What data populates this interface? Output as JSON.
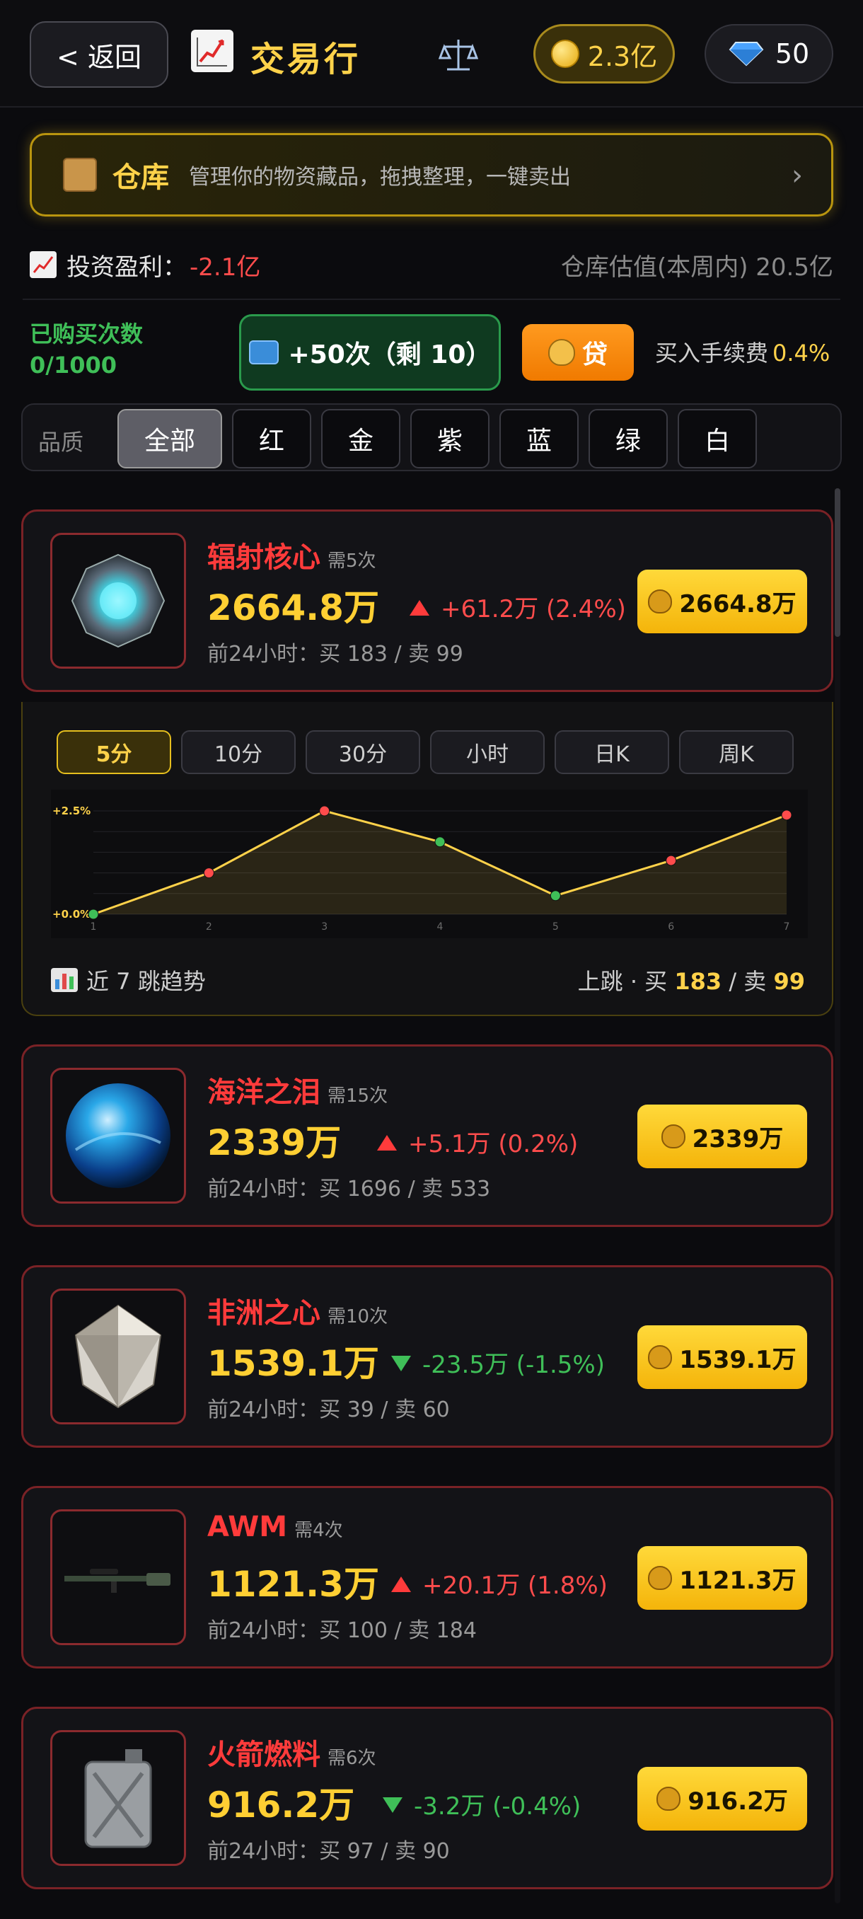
{
  "header": {
    "back_label": "< 返回",
    "title": "交易行",
    "gold_balance": "2.3亿",
    "gem_balance": "50"
  },
  "banner": {
    "title": "仓库",
    "desc": "管理你的物资藏品，拖拽整理，一键卖出",
    "arrow": "›"
  },
  "profit": {
    "label": "投资盈利：",
    "value": "-2.1亿",
    "valuation": "仓库估值(本周内) 20.5亿"
  },
  "buy": {
    "bought_label": "已购买次数",
    "bought_count": "0/1000",
    "plus50_label": "+50次（剩 10）",
    "loan_label": "贷",
    "fee_label": "买入手续费",
    "fee_value": "0.4%"
  },
  "filter": {
    "label": "品质",
    "options": [
      "全部",
      "红",
      "金",
      "紫",
      "蓝",
      "绿",
      "白"
    ],
    "selected": "全部"
  },
  "items": [
    {
      "name": "辐射核心",
      "need": "需5次",
      "price": "2664.8万",
      "change": "+61.2万 (2.4%)",
      "direction": "up",
      "stats": "前24小时：买 183 / 卖 99",
      "buy_label": "2664.8万"
    },
    {
      "name": "海洋之泪",
      "need": "需15次",
      "price": "2339万",
      "change": "+5.1万 (0.2%)",
      "direction": "up",
      "stats": "前24小时：买 1696 / 卖 533",
      "buy_label": "2339万"
    },
    {
      "name": "非洲之心",
      "need": "需10次",
      "price": "1539.1万",
      "change": "-23.5万 (-1.5%)",
      "direction": "down",
      "stats": "前24小时：买 39 / 卖 60",
      "buy_label": "1539.1万"
    },
    {
      "name": "AWM",
      "need": "需4次",
      "price": "1121.3万",
      "change": "+20.1万 (1.8%)",
      "direction": "up",
      "stats": "前24小时：买 100 / 卖 184",
      "buy_label": "1121.3万"
    },
    {
      "name": "火箭燃料",
      "need": "需6次",
      "price": "916.2万",
      "change": "-3.2万 (-0.4%)",
      "direction": "down",
      "stats": "前24小时：买 97 / 卖 90",
      "buy_label": "916.2万"
    }
  ],
  "trend": {
    "periods": [
      "5分",
      "10分",
      "30分",
      "小时",
      "日K",
      "周K"
    ],
    "selected_period": "5分",
    "footer_label": "近 7 跳趋势",
    "footer_prefix": "上跳 · 买",
    "buy_count": "183",
    "sep": "/ 卖",
    "sell_count": "99"
  },
  "chart_data": {
    "type": "line",
    "x": [
      1,
      2,
      3,
      4,
      5,
      6,
      7
    ],
    "values": [
      0.0,
      1.0,
      2.5,
      1.75,
      0.45,
      1.3,
      2.4
    ],
    "point_colors": [
      "#3fbf58",
      "#ff4c4c",
      "#ff4c4c",
      "#3fbf58",
      "#3fbf58",
      "#ff4c4c",
      "#ff4c4c"
    ],
    "y_tick_labels": [
      "+2.5%",
      "+0.0%"
    ],
    "ylim": [
      0,
      2.5
    ],
    "line_color": "#ffd24a",
    "grid": true
  },
  "colors": {
    "gold": "#ffd24a",
    "red": "#ff3b3b",
    "green": "#3fbf58",
    "card_border": "#7a2226"
  }
}
